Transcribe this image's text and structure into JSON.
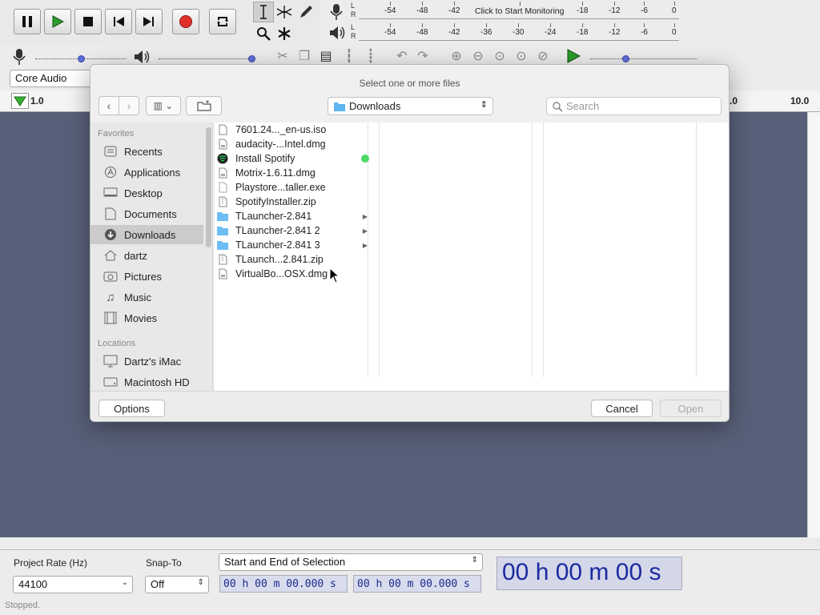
{
  "app": {
    "transport": {
      "pause": "pause-icon",
      "play": "play-icon",
      "stop": "stop-icon",
      "skip_start": "skip-to-start-icon",
      "skip_end": "skip-to-end-icon",
      "record": "record-icon",
      "loop": "loop-icon"
    },
    "meters": {
      "record_ticks": [
        "-54",
        "-48",
        "-42",
        "Click to Start Monitoring",
        "-18",
        "-12",
        "-6",
        "0"
      ],
      "play_ticks": [
        "-54",
        "-48",
        "-42",
        "-36",
        "-30",
        "-24",
        "-18",
        "-12",
        "-6",
        "0"
      ],
      "lr": [
        "L",
        "R"
      ]
    },
    "host": "Core Audio",
    "ruler": {
      "left": "1.0",
      "right_a": ".0",
      "right_b": "10.0"
    },
    "bottom": {
      "project_rate_label": "Project Rate (Hz)",
      "project_rate_value": "44100",
      "snap_label": "Snap-To",
      "snap_value": "Off",
      "selection_mode": "Start and End of Selection",
      "sel_start": "00 h 00 m 00.000 s",
      "sel_end": "00 h 00 m 00.000 s",
      "audio_position": "00 h 00 m 00 s"
    },
    "status": "Stopped."
  },
  "dialog": {
    "title": "Select one or more files",
    "location": "Downloads",
    "search_placeholder": "Search",
    "favorites_header": "Favorites",
    "favorites": [
      {
        "label": "Recents",
        "icon": "recents-icon"
      },
      {
        "label": "Applications",
        "icon": "applications-icon"
      },
      {
        "label": "Desktop",
        "icon": "desktop-icon"
      },
      {
        "label": "Documents",
        "icon": "documents-icon"
      },
      {
        "label": "Downloads",
        "icon": "downloads-icon"
      },
      {
        "label": "dartz",
        "icon": "home-icon"
      },
      {
        "label": "Pictures",
        "icon": "pictures-icon"
      },
      {
        "label": "Music",
        "icon": "music-icon"
      },
      {
        "label": "Movies",
        "icon": "movies-icon"
      }
    ],
    "locations_header": "Locations",
    "locations": [
      {
        "label": "Dartz's iMac",
        "icon": "computer-icon"
      },
      {
        "label": "Macintosh HD",
        "icon": "disk-icon"
      }
    ],
    "files": [
      {
        "name": "7601.24..._en-us.iso",
        "type": "file"
      },
      {
        "name": "audacity-...Intel.dmg",
        "type": "file"
      },
      {
        "name": "Install Spotify",
        "type": "app",
        "tag_color": "#4cd964"
      },
      {
        "name": "Motrix-1.6.11.dmg",
        "type": "file"
      },
      {
        "name": "Playstore...taller.exe",
        "type": "file"
      },
      {
        "name": "SpotifyInstaller.zip",
        "type": "file"
      },
      {
        "name": "TLauncher-2.841",
        "type": "folder"
      },
      {
        "name": "TLauncher-2.841 2",
        "type": "folder"
      },
      {
        "name": "TLauncher-2.841 3",
        "type": "folder"
      },
      {
        "name": "TLaunch...2.841.zip",
        "type": "file"
      },
      {
        "name": "VirtualBo...OSX.dmg",
        "type": "file"
      }
    ],
    "options_label": "Options",
    "cancel_label": "Cancel",
    "open_label": "Open"
  },
  "colors": {
    "track_bg": "#586079",
    "record_red": "#e0302a",
    "play_green": "#2d9b2d",
    "time_blue": "#1d2aa0"
  }
}
